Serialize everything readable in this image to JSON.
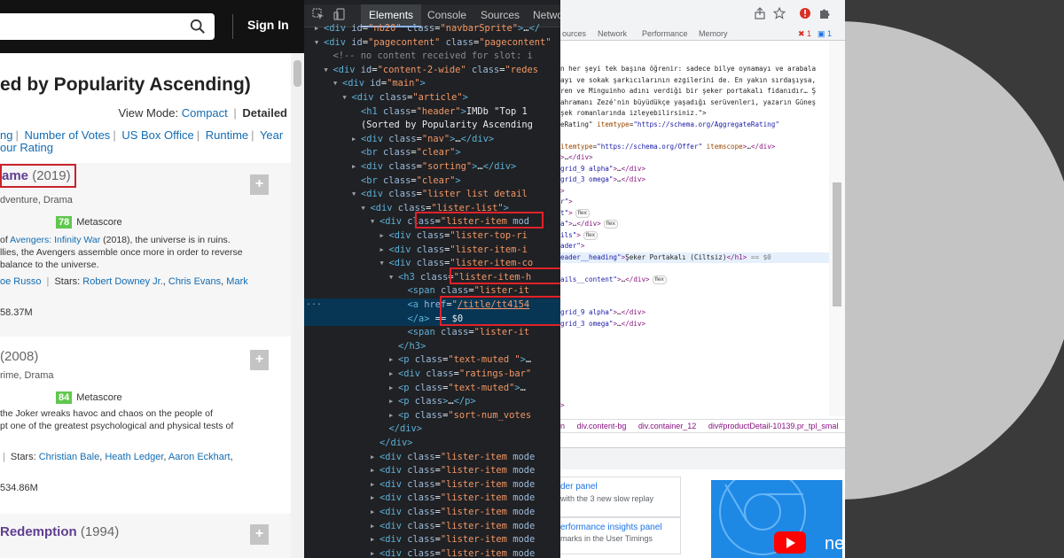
{
  "imdb": {
    "signin_label": "Sign In",
    "page_heading": "ed by Popularity Ascending)",
    "view_mode": {
      "label": "View Mode:",
      "compact": "Compact",
      "separator": "|",
      "detailed": "Detailed"
    },
    "sort_links": {
      "row1": [
        "ng",
        "Number of Votes",
        "US Box Office",
        "Runtime",
        "Year"
      ],
      "row2": "our Rating"
    },
    "items": [
      {
        "title": "ame",
        "year": "(2019)",
        "genre": "dventure, Drama",
        "metascore": "78",
        "metascore_label": "Metascore",
        "desc_prefix": "of ",
        "desc_link1": "Avengers: Infinity War",
        "desc_rest1": " (2018), the universe is in ruins.",
        "desc_line2": "llies, the Avengers assemble once more in order to reverse",
        "desc_line3": "balance to the universe.",
        "director_fragment": "oe Russo",
        "stars_label": "Stars:",
        "stars": [
          "Robert Downey Jr.",
          "Chris Evans",
          "Mark"
        ],
        "gross": "58.37M"
      },
      {
        "title": "",
        "year": "(2008)",
        "genre": "rime, Drama",
        "metascore": "84",
        "metascore_label": "Metascore",
        "desc_line1": "the Joker wreaks havoc and chaos on the people of",
        "desc_line2": "pt one of the greatest psychological and physical tests of",
        "stars_label": "Stars:",
        "stars": [
          "Christian Bale",
          "Heath Ledger",
          "Aaron Eckhart"
        ],
        "gross": "534.86M"
      },
      {
        "title": "Redemption",
        "year": "(1994)"
      }
    ]
  },
  "devtools": {
    "tabs": [
      "Elements",
      "Console",
      "Sources",
      "Netwo"
    ],
    "active_tab": "Elements",
    "ellipsis": "...",
    "lines": [
      {
        "indent": 0,
        "arrow": "▶",
        "html": "<span class='tg'>&lt;div</span> <span class='at'>id</span>=<span class='av'>\"nb20\"</span> <span class='at'>class</span>=<span class='av'>\"navbarSprite\"</span><span class='tg'>&gt;</span>…<span class='tg'>&lt;/</span>"
      },
      {
        "indent": 0,
        "arrow": "▼",
        "html": "<span class='tg'>&lt;div</span> <span class='at'>id</span>=<span class='av'>\"pagecontent\"</span> <span class='at'>class</span>=<span class='av'>\"pagecontent\"</span>"
      },
      {
        "indent": 1,
        "arrow": "",
        "html": "<span class='cm'>&lt;!-- no content received for slot: i</span>"
      },
      {
        "indent": 1,
        "arrow": "▼",
        "html": "<span class='tg'>&lt;div</span> <span class='at'>id</span>=<span class='av'>\"content-2-wide\"</span> <span class='at'>class</span>=<span class='av'>\"redes</span>"
      },
      {
        "indent": 2,
        "arrow": "▼",
        "html": "<span class='tg'>&lt;div</span> <span class='at'>id</span>=<span class='av'>\"main\"</span><span class='tg'>&gt;</span>"
      },
      {
        "indent": 3,
        "arrow": "▼",
        "html": "<span class='tg'>&lt;div</span> <span class='at'>class</span>=<span class='av'>\"article\"</span><span class='tg'>&gt;</span>"
      },
      {
        "indent": 4,
        "arrow": "",
        "html": "<span class='tg'>&lt;h1</span> <span class='at'>class</span>=<span class='av'>\"header\"</span><span class='tg'>&gt;</span><span class='tx'>IMDb \"Top 1</span>"
      },
      {
        "indent": 4,
        "arrow": "",
        "html": "<span class='tx'>(Sorted by Popularity Ascending</span>"
      },
      {
        "indent": 4,
        "arrow": "▶",
        "html": "<span class='tg'>&lt;div</span> <span class='at'>class</span>=<span class='av'>\"nav\"</span><span class='tg'>&gt;</span>…<span class='tg'>&lt;/div&gt;</span>"
      },
      {
        "indent": 4,
        "arrow": "",
        "html": "<span class='tg'>&lt;br</span> <span class='at'>class</span>=<span class='av'>\"clear\"</span><span class='tg'>&gt;</span>"
      },
      {
        "indent": 4,
        "arrow": "▶",
        "html": "<span class='tg'>&lt;div</span> <span class='at'>class</span>=<span class='av'>\"sorting\"</span><span class='tg'>&gt;</span>…<span class='tg'>&lt;/div&gt;</span>"
      },
      {
        "indent": 4,
        "arrow": "",
        "html": "<span class='tg'>&lt;br</span> <span class='at'>class</span>=<span class='av'>\"clear\"</span><span class='tg'>&gt;</span>"
      },
      {
        "indent": 4,
        "arrow": "▼",
        "html": "<span class='tg'>&lt;div</span> <span class='at'>class</span>=<span class='av'>\"lister list detail</span>"
      },
      {
        "indent": 5,
        "arrow": "▼",
        "html": "<span class='tg'>&lt;div</span> <span class='at'>class</span>=<span class='av'>\"lister-list\"</span><span class='tg'>&gt;</span>"
      },
      {
        "indent": 6,
        "arrow": "▼",
        "html": "<span class='tg'>&lt;div</span> <span class='at'>class</span>=<span class='av'>\"lister-item</span> <span class='at'>mod</span>"
      },
      {
        "indent": 7,
        "arrow": "▶",
        "html": "<span class='tg'>&lt;div</span> <span class='at'>class</span>=<span class='av'>\"lister-top-ri</span>"
      },
      {
        "indent": 7,
        "arrow": "▶",
        "html": "<span class='tg'>&lt;div</span> <span class='at'>class</span>=<span class='av'>\"lister-item-i</span>"
      },
      {
        "indent": 7,
        "arrow": "▼",
        "html": "<span class='tg'>&lt;div</span> <span class='at'>class</span>=<span class='av'>\"lister-item-co</span>"
      },
      {
        "indent": 8,
        "arrow": "▼",
        "html": "<span class='tg'>&lt;h3</span> <span class='at'>class</span>=<span class='av'>\"lister-item-h</span>"
      },
      {
        "indent": 9,
        "arrow": "",
        "html": "<span class='tg'>&lt;span</span> <span class='at'>class</span>=<span class='av'>\"lister-it</span>"
      },
      {
        "indent": 9,
        "arrow": "",
        "html": "<span class='tg'>&lt;a</span> <span class='at'>href</span>=<span class='av'>\"<u>/title/tt4154</u></span>",
        "selected": true
      },
      {
        "indent": 9,
        "arrow": "",
        "html": "<span class='tg'>&lt;/a&gt;</span> <span class='tx'>== $0</span>",
        "selected": true
      },
      {
        "indent": 9,
        "arrow": "",
        "html": "<span class='tg'>&lt;span</span> <span class='at'>class</span>=<span class='av'>\"lister-it</span>"
      },
      {
        "indent": 8,
        "arrow": "",
        "html": "<span class='tg'>&lt;/h3&gt;</span>"
      },
      {
        "indent": 8,
        "arrow": "▶",
        "html": "<span class='tg'>&lt;p</span> <span class='at'>class</span>=<span class='av'>\"text-muted \"</span><span class='tg'>&gt;</span>…"
      },
      {
        "indent": 8,
        "arrow": "▶",
        "html": "<span class='tg'>&lt;div</span> <span class='at'>class</span>=<span class='av'>\"ratings-bar\"</span>"
      },
      {
        "indent": 8,
        "arrow": "▶",
        "html": "<span class='tg'>&lt;p</span> <span class='at'>class</span>=<span class='av'>\"text-muted\"</span><span class='tg'>&gt;</span>…"
      },
      {
        "indent": 8,
        "arrow": "▶",
        "html": "<span class='tg'>&lt;p</span> <span class='at'>class</span><span class='tg'>&gt;</span>…<span class='tg'>&lt;/p&gt;</span>"
      },
      {
        "indent": 8,
        "arrow": "▶",
        "html": "<span class='tg'>&lt;p</span> <span class='at'>class</span>=<span class='av'>\"sort-num_votes</span>"
      },
      {
        "indent": 7,
        "arrow": "",
        "html": "<span class='tg'>&lt;/div&gt;</span>"
      },
      {
        "indent": 6,
        "arrow": "",
        "html": "<span class='tg'>&lt;/div&gt;</span>"
      },
      {
        "indent": 6,
        "arrow": "▶",
        "html": "<span class='tg'>&lt;div</span> <span class='at'>class</span>=<span class='av'>\"lister-item</span> <span class='at'>mode</span>"
      },
      {
        "indent": 6,
        "arrow": "▶",
        "html": "<span class='tg'>&lt;div</span> <span class='at'>class</span>=<span class='av'>\"lister-item</span> <span class='at'>mode</span>"
      },
      {
        "indent": 6,
        "arrow": "▶",
        "html": "<span class='tg'>&lt;div</span> <span class='at'>class</span>=<span class='av'>\"lister-item</span> <span class='at'>mode</span>"
      },
      {
        "indent": 6,
        "arrow": "▶",
        "html": "<span class='tg'>&lt;div</span> <span class='at'>class</span>=<span class='av'>\"lister-item</span> <span class='at'>mode</span>"
      },
      {
        "indent": 6,
        "arrow": "▶",
        "html": "<span class='tg'>&lt;div</span> <span class='at'>class</span>=<span class='av'>\"lister-item</span> <span class='at'>mode</span>"
      },
      {
        "indent": 6,
        "arrow": "▶",
        "html": "<span class='tg'>&lt;div</span> <span class='at'>class</span>=<span class='av'>\"lister-item</span> <span class='at'>mode</span>"
      },
      {
        "indent": 6,
        "arrow": "▶",
        "html": "<span class='tg'>&lt;div</span> <span class='at'>class</span>=<span class='av'>\"lister-item</span> <span class='at'>mode</span>"
      },
      {
        "indent": 6,
        "arrow": "▶",
        "html": "<span class='tg'>&lt;div</span> <span class='at'>class</span>=<span class='av'>\"lister-item</span> <span class='at'>mode</span>"
      }
    ]
  },
  "devtools_light": {
    "tabs": [
      "ources",
      "Network",
      "Performance",
      "Memory"
    ],
    "errors": "1",
    "messages": "1",
    "lines": [
      {
        "html": "n her şeyi tek başına öğrenir: sadece bilye oynamayı ve arabala"
      },
      {
        "html": "ayı ve sokak şarkıcılarının ezgilerini de. En yakın sırdaşıysa,"
      },
      {
        "html": "ren ve Minguinho adını verdiği bir şeker portakalı fidanıdır… Ş"
      },
      {
        "html": "ahramanı Zezé'nin büyüdükçe yaşadığı serüvenleri, yazarın Güneş"
      },
      {
        "html": "şek romanlarında izleyebilirsiniz.\">"
      },
      {
        "html": "eRating\" <span class='la'>itemtype</span>=<span class='lv'>\"https://schema.org/AggregateRating\"</span>"
      },
      {
        "html": ""
      },
      {
        "html": "<span class='la'>itemtype</span>=<span class='lv'>\"https://schema.org/Offer\"</span> <span class='la'>itemscope</span><span class='lt'>&gt;</span>…<span class='lt'>&lt;/div&gt;</span>"
      },
      {
        "html": "<span class='lt'>&gt;</span>…<span class='lt'>&lt;/div&gt;</span>"
      },
      {
        "html": "<span class='lv'>grid_9 alpha\"</span><span class='lt'>&gt;</span>…<span class='lt'>&lt;/div&gt;</span>"
      },
      {
        "html": "<span class='lv'>grid_3 omega\"</span><span class='lt'>&gt;</span>…<span class='lt'>&lt;/div&gt;</span>"
      },
      {
        "html": "<span class='lt'>&gt;</span>"
      },
      {
        "html": "<span class='lv'>r\"</span><span class='lt'>&gt;</span>"
      },
      {
        "html": "<span class='lv'>t\"</span><span class='lt'>&gt;</span><span class='flex-pill'>flex</span>"
      },
      {
        "html": "<span class='lv'>a\"</span><span class='lt'>&gt;</span>…<span class='lt'>&lt;/div&gt;</span><span class='flex-pill'>flex</span>"
      },
      {
        "html": "<span class='lv'>ils\"</span><span class='lt'>&gt;</span><span class='flex-pill'>flex</span>"
      },
      {
        "html": "<span class='lv'>ader\"</span><span class='lt'>&gt;</span>"
      },
      {
        "html": "<span class='lv'>eader__heading\"</span><span class='lt'>&gt;</span>Şeker Portakalı (Ciltsiz)<span class='lt'>&lt;/h1&gt;</span> <span style='color:#777'>== $0</span>",
        "hl": true
      },
      {
        "html": ""
      },
      {
        "html": "<span class='lv'>ails__content\"</span><span class='lt'>&gt;</span>…<span class='lt'>&lt;/div&gt;</span><span class='flex-pill'>flex</span>"
      },
      {
        "html": ""
      },
      {
        "html": ""
      },
      {
        "html": "<span class='lv'>grid_9 alpha\"</span><span class='lt'>&gt;</span>…<span class='lt'>&lt;/div&gt;</span>"
      },
      {
        "html": "<span class='lv'>grid_3 omega\"</span><span class='lt'>&gt;</span>…<span class='lt'>&lt;/div&gt;</span>"
      }
    ],
    "tail_line": "<span class='lt'>&gt;</span>",
    "breadcrumbs": [
      "n",
      "div.content-bg",
      "div.container_12",
      "div#productDetail-10139.pr_tpl_smal"
    ],
    "cards": [
      {
        "title": "der panel",
        "desc": "with the 3 new slow replay"
      },
      {
        "title": "erformance insights panel",
        "desc": "marks in the User Timings"
      }
    ],
    "video_text": "ne"
  }
}
